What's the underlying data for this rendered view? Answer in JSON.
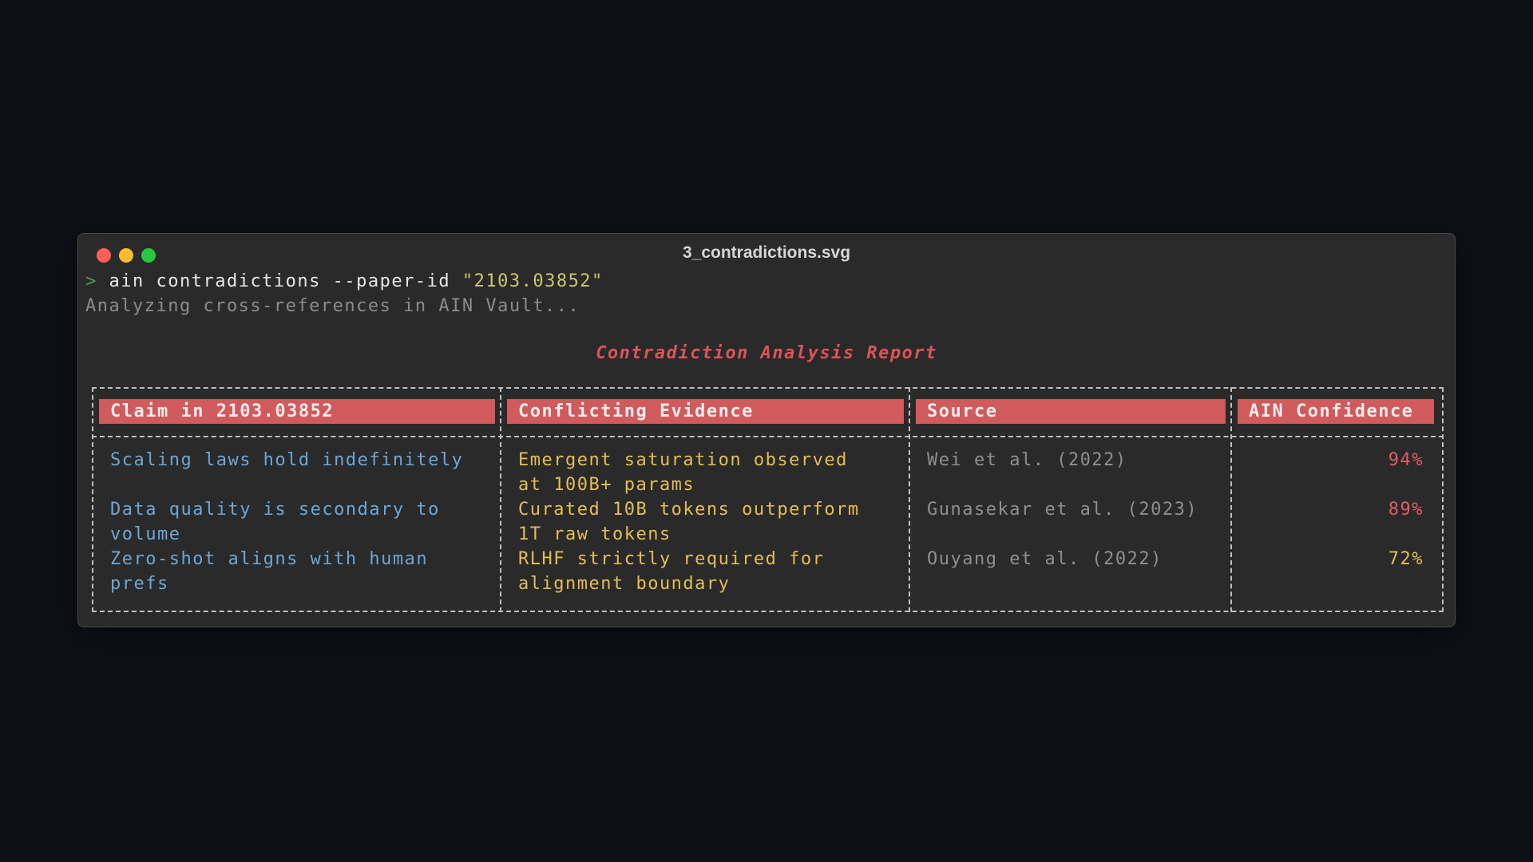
{
  "window": {
    "title": "3_contradictions.svg"
  },
  "terminal": {
    "prompt_symbol": ">",
    "command": "ain contradictions --paper-id ",
    "command_arg": "\"2103.03852\"",
    "status": "Analyzing cross-references in AIN Vault..."
  },
  "report": {
    "title": "Contradiction Analysis Report",
    "columns": [
      "Claim in 2103.03852",
      "Conflicting Evidence",
      "Source",
      "AIN Confidence"
    ],
    "rows": [
      {
        "claim": [
          "Scaling laws hold indefinitely"
        ],
        "evidence": [
          "Emergent saturation observed",
          "at 100B+ params"
        ],
        "source": "Wei et al. (2022)",
        "confidence": "94%",
        "confidence_color": "#e05c63"
      },
      {
        "claim": [
          "Data quality is secondary to",
          "volume"
        ],
        "evidence": [
          "Curated 10B tokens outperform",
          "1T raw tokens"
        ],
        "source": "Gunasekar et al. (2023)",
        "confidence": "89%",
        "confidence_color": "#e05c63"
      },
      {
        "claim": [
          "Zero-shot aligns with human",
          "prefs"
        ],
        "evidence": [
          "RLHF strictly required for",
          "alignment boundary"
        ],
        "source": "Ouyang et al. (2022)",
        "confidence": "72%",
        "confidence_color": "#e3be52"
      }
    ]
  },
  "colors": {
    "background": "#0d1117",
    "window": "#2a2a2a",
    "header_fill": "#d05a5c",
    "report_title": "#d9555a",
    "claim_text": "#6aa7d6",
    "evidence_text": "#e3be52",
    "source_text": "#8f8f8f"
  }
}
